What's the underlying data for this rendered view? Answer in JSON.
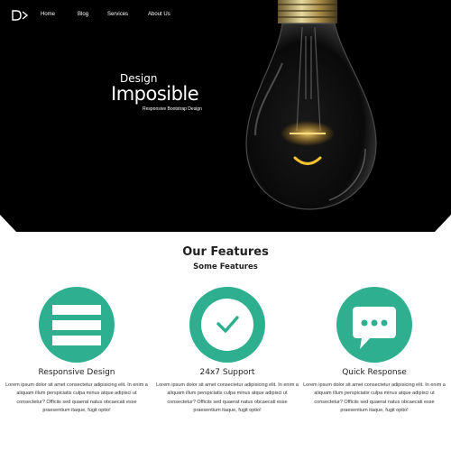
{
  "nav": {
    "logo": "D>",
    "items": [
      "Home",
      "Blog",
      "Services",
      "About Us"
    ]
  },
  "hero": {
    "line1": "Design",
    "line2": "Imposible",
    "subtitle": "Responsive Bootstrap Design"
  },
  "features": {
    "title": "Our Features",
    "subtitle": "Some Features",
    "items": [
      {
        "icon": "menu-icon",
        "title": "Responsive Design",
        "text": "Lorem ipsum dolor sit amet consectetur adipisicing elit. In enim a aliquam illum perspiciatis culpa minus atque adipisci ut consectetur? Officiis sed quaerat natus obcaecati esse praesentium itaque, fugit optio!"
      },
      {
        "icon": "check-circle-icon",
        "title": "24x7 Support",
        "text": "Lorem ipsum dolor sit amet consectetur adipisicing elit. In enim a aliquam illum perspiciatis culpa minus atque adipisci ut consectetur? Officiis sed quaerat natus obcaecati esse praesentium itaque, fugit optio!"
      },
      {
        "icon": "chat-bubble-icon",
        "title": "Quick Response",
        "text": "Lorem ipsum dolor sit amet consectetur adipisicing elit. In enim a aliquam illum perspiciatis culpa minus atque adipisci ut consectetur? Officiis sed quaerat natus obcaecati esse praesentium itaque, fugit optio!"
      }
    ]
  },
  "colors": {
    "accent": "#2eb090",
    "hero_bg": "#000000"
  }
}
